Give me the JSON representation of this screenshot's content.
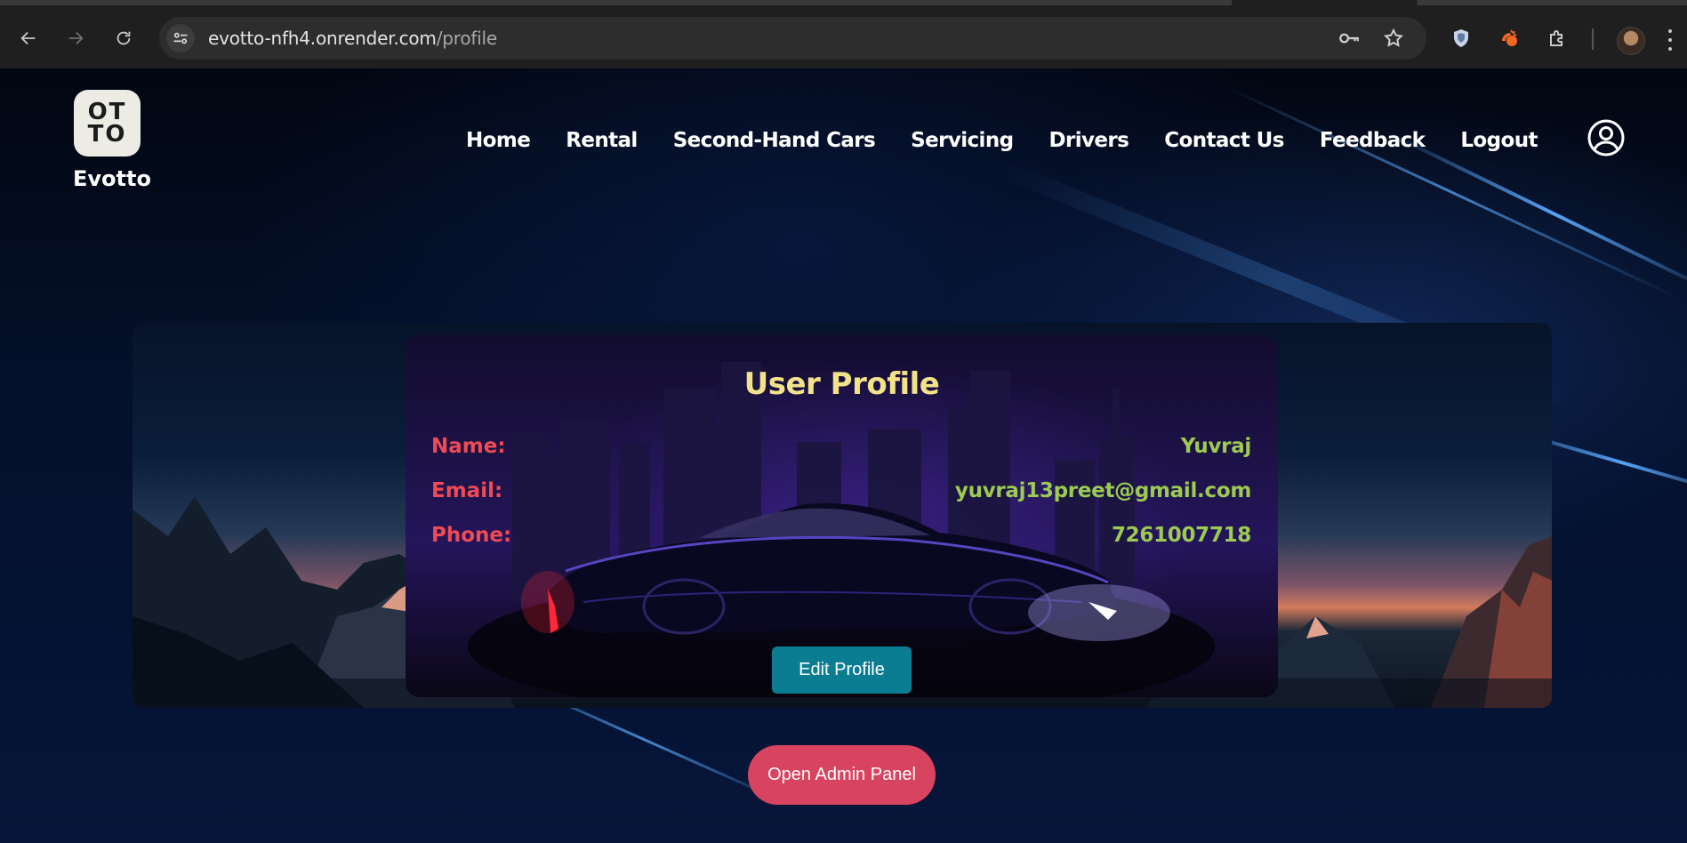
{
  "browser": {
    "url_host": "evotto-nfh4.onrender.com",
    "url_path": "/profile",
    "icons": [
      "back-arrow-icon",
      "forward-arrow-icon",
      "reload-icon",
      "site-info-icon",
      "password-key-icon",
      "bookmark-star-icon",
      "shield-extension-icon",
      "orange-extension-icon",
      "extensions-puzzle-icon",
      "profile-avatar-icon",
      "menu-kebab-icon"
    ]
  },
  "header": {
    "logo_line1": "OT",
    "logo_line2": "TO",
    "brand": "Evotto",
    "nav": [
      "Home",
      "Rental",
      "Second-Hand Cars",
      "Servicing",
      "Drivers",
      "Contact Us",
      "Feedback",
      "Logout"
    ]
  },
  "profile": {
    "title": "User Profile",
    "rows": [
      {
        "label": "Name:",
        "value": "Yuvraj"
      },
      {
        "label": "Email:",
        "value": "yuvraj13preet@gmail.com"
      },
      {
        "label": "Phone:",
        "value": "7261007718"
      }
    ],
    "edit_button": "Edit Profile"
  },
  "admin_button": "Open Admin Panel",
  "colors": {
    "title": "#f2e38a",
    "label": "#f04a55",
    "value": "#9dcb52",
    "edit_button": "#0b7d92",
    "admin_button": "#d8435f"
  }
}
